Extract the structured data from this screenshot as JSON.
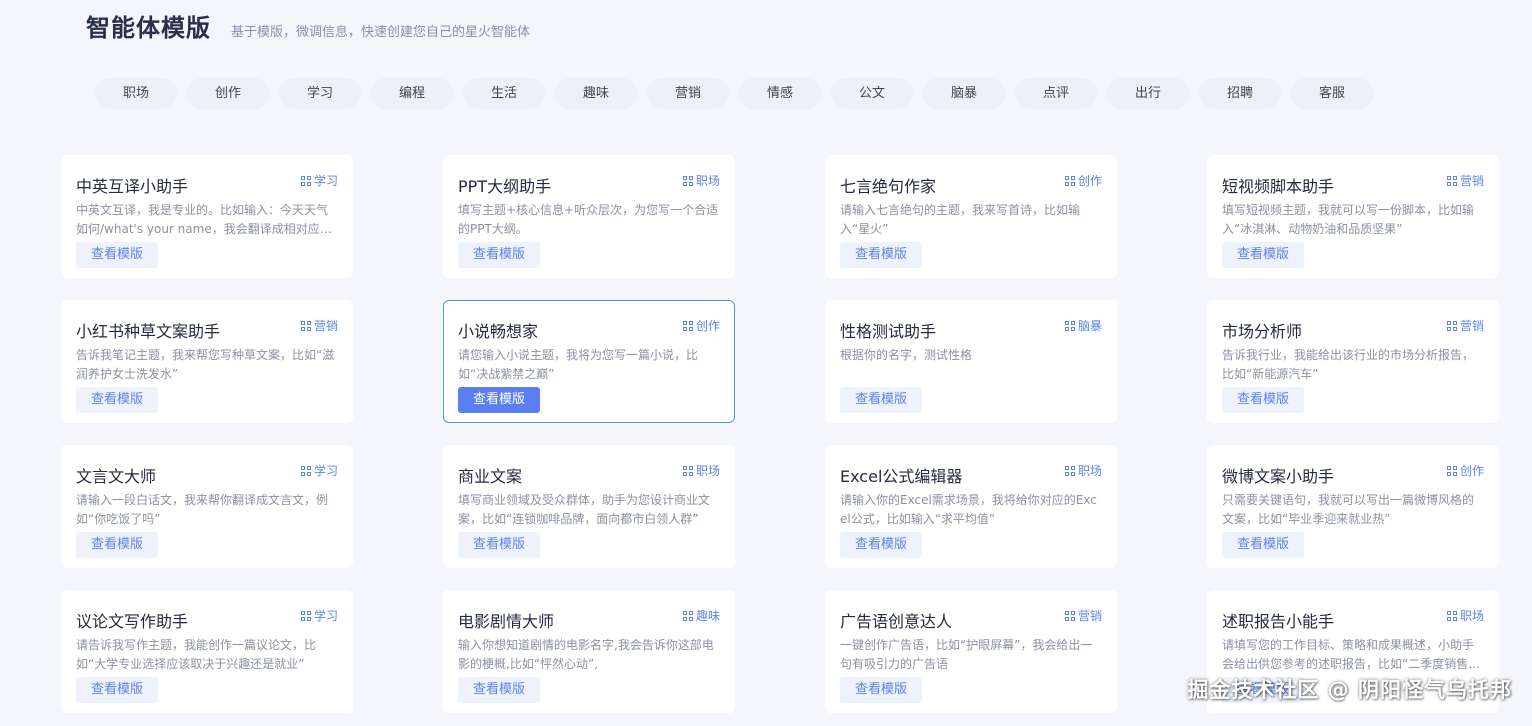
{
  "header": {
    "title": "智能体模版",
    "subtitle": "基于模版，微调信息，快速创建您自己的星火智能体"
  },
  "categories": [
    "职场",
    "创作",
    "学习",
    "编程",
    "生活",
    "趣味",
    "营销",
    "情感",
    "公文",
    "脑暴",
    "点评",
    "出行",
    "招聘",
    "客服"
  ],
  "cards": [
    {
      "name": "中英互译小助手",
      "tag": "学习",
      "desc": "中英文互译，我是专业的。比如输入：今天天气如何/what's your name，我会翻译成相对应的英文或中文。",
      "button": "查看模版"
    },
    {
      "name": "PPT大纲助手",
      "tag": "职场",
      "desc": "填写主题+核心信息+听众层次，为您写一个合适的PPT大纲。",
      "button": "查看模版"
    },
    {
      "name": "七言绝句作家",
      "tag": "创作",
      "desc": "请输入七言绝句的主题，我来写首诗，比如输入“星火”",
      "button": "查看模版"
    },
    {
      "name": "短视频脚本助手",
      "tag": "营销",
      "desc": "填写短视频主题，我就可以写一份脚本，比如输入“冰淇淋、动物奶油和品质坚果”",
      "button": "查看模版"
    },
    {
      "name": "小红书种草文案助手",
      "tag": "营销",
      "desc": "告诉我笔记主题，我来帮您写种草文案，比如“滋润养护女士洗发水”",
      "button": "查看模版"
    },
    {
      "name": "小说畅想家",
      "tag": "创作",
      "desc": "请您输入小说主题，我将为您写一篇小说，比如“决战紫禁之巅”",
      "button": "查看模版",
      "active": true
    },
    {
      "name": "性格测试助手",
      "tag": "脑暴",
      "desc": "根据你的名字，测试性格",
      "button": "查看模版"
    },
    {
      "name": "市场分析师",
      "tag": "营销",
      "desc": "告诉我行业，我能给出该行业的市场分析报告，比如“新能源汽车”",
      "button": "查看模版"
    },
    {
      "name": "文言文大师",
      "tag": "学习",
      "desc": "请输入一段白话文，我来帮你翻译成文言文，例如“你吃饭了吗”",
      "button": "查看模版"
    },
    {
      "name": "商业文案",
      "tag": "职场",
      "desc": "填写商业领域及受众群体，助手为您设计商业文案，比如“连锁咖啡品牌，面向都市白领人群”",
      "button": "查看模版"
    },
    {
      "name": "Excel公式编辑器",
      "tag": "职场",
      "desc": "请输入你的Excel需求场景，我将给你对应的Excel公式，比如输入“求平均值”",
      "button": "查看模版"
    },
    {
      "name": "微博文案小助手",
      "tag": "创作",
      "desc": "只需要关键语句，我就可以写出一篇微博风格的文案，比如“毕业季迎来就业热”",
      "button": "查看模版"
    },
    {
      "name": "议论文写作助手",
      "tag": "学习",
      "desc": "请告诉我写作主题，我能创作一篇议论文，比如“大学专业选择应该取决于兴趣还是就业”",
      "button": "查看模版"
    },
    {
      "name": "电影剧情大师",
      "tag": "趣味",
      "desc": "输入你想知道剧情的电影名字,我会告诉你这部电影的梗概,比如“怦然心动”,",
      "button": "查看模版"
    },
    {
      "name": "广告语创意达人",
      "tag": "营销",
      "desc": "一键创作广告语，比如“护眼屏幕”，我会给出一句有吸引力的广告语",
      "button": "查看模版"
    },
    {
      "name": "述职报告小能手",
      "tag": "职场",
      "desc": "请填写您的工作目标、策略和成果概述，小助手会给出供您参考的述职报告，比如“二季度销售额增长”",
      "button": "查看模版"
    }
  ],
  "watermark": "掘金技术社区 @ 阴阳怪气乌托邦"
}
